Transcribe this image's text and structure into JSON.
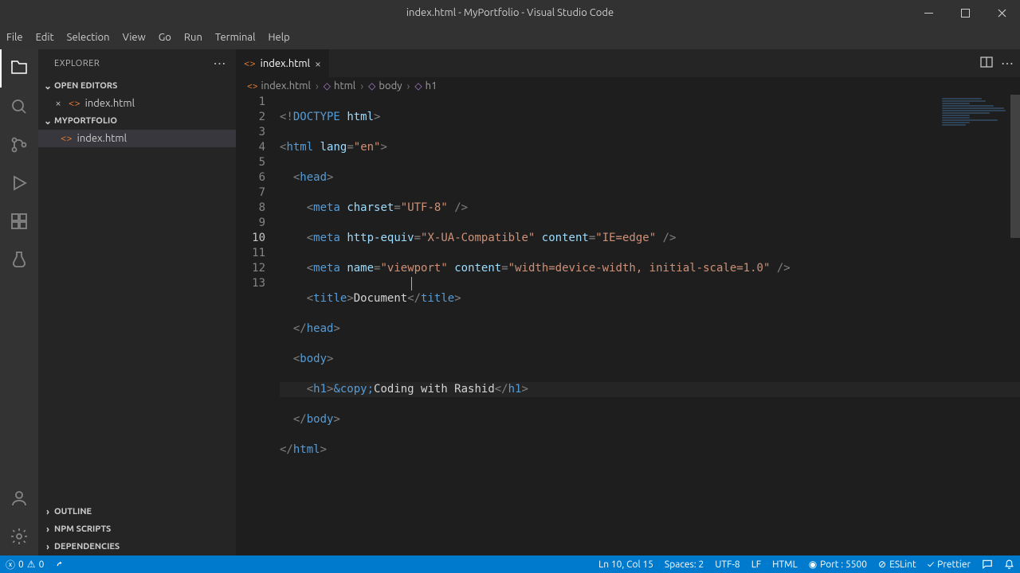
{
  "window": {
    "title": "index.html - MyPortfolio - Visual Studio Code"
  },
  "menus": [
    "File",
    "Edit",
    "Selection",
    "View",
    "Go",
    "Run",
    "Terminal",
    "Help"
  ],
  "sidebar": {
    "title": "EXPLORER",
    "sections": {
      "open_editors": {
        "label": "OPEN EDITORS",
        "items": [
          {
            "name": "index.html"
          }
        ]
      },
      "folder": {
        "label": "MYPORTFOLIO",
        "items": [
          {
            "name": "index.html"
          }
        ]
      },
      "outline": {
        "label": "OUTLINE"
      },
      "npm": {
        "label": "NPM SCRIPTS"
      },
      "deps": {
        "label": "DEPENDENCIES"
      }
    }
  },
  "tab": {
    "name": "index.html"
  },
  "breadcrumbs": {
    "file": "index.html",
    "parts": [
      {
        "icon": "⃞",
        "label": "html"
      },
      {
        "icon": "⃞",
        "label": "body"
      },
      {
        "icon": "⃞",
        "label": "h1"
      }
    ]
  },
  "code": {
    "lang": "en",
    "charset": "UTF-8",
    "http_equiv": "X-UA-Compatible",
    "ie_edge": "IE=edge",
    "viewport_name": "viewport",
    "viewport_content": "width=device-width, initial-scale=1.0",
    "title_text": "Document",
    "entity": "&copy;",
    "h1_text": "Coding with Rashid"
  },
  "lineNumbers": [
    "1",
    "2",
    "3",
    "4",
    "5",
    "6",
    "7",
    "8",
    "9",
    "10",
    "11",
    "12",
    "13"
  ],
  "currentLine": "10",
  "status": {
    "errors": "0",
    "warnings": "0",
    "lncol": "Ln 10, Col 15",
    "spaces": "Spaces: 2",
    "encoding": "UTF-8",
    "eol": "LF",
    "lang": "HTML",
    "port": "Port : 5500",
    "eslint": "ESLint",
    "prettier": "Prettier"
  }
}
